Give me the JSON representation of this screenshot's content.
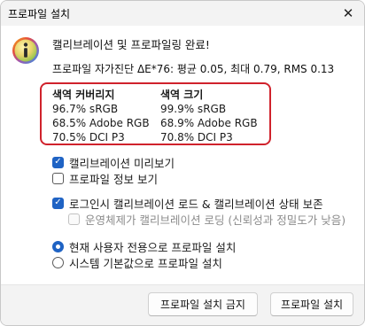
{
  "window": {
    "title": "프로파일 설치"
  },
  "message": {
    "heading": "캘리브레이션 및 프로파일링 완료!",
    "deltae": "프로파일 자가진단 ΔE*76: 평균 0.05, 최대 0.79, RMS 0.13"
  },
  "gamut": {
    "coverage": {
      "header": "색역 커버리지",
      "rows": [
        "96.7% sRGB",
        "68.5% Adobe RGB",
        "70.5% DCI P3"
      ]
    },
    "size": {
      "header": "색역 크기",
      "rows": [
        "99.9% sRGB",
        "68.9% Adobe RGB",
        "70.8% DCI P3"
      ]
    }
  },
  "options": {
    "preview": {
      "label": "캘리브레이션 미리보기",
      "checked": true
    },
    "profile_info": {
      "label": "프로파일 정보 보기",
      "checked": false
    },
    "login_load": {
      "label": "로그인시 캘리브레이션 로드 & 캘리브레이션 상태 보존",
      "checked": true
    },
    "os_load": {
      "label": "운영체제가 캘리브레이션 로딩 (신뢰성과 정밀도가 낮음)",
      "checked": false,
      "disabled": true
    }
  },
  "install_scope": {
    "current_user": {
      "label": "현재 사용자 전용으로 프로파일 설치",
      "selected": true
    },
    "system_default": {
      "label": "시스템 기본값으로 프로파일 설치",
      "selected": false
    }
  },
  "buttons": {
    "no_install": "프로파일 설치 금지",
    "install": "프로파일 설치"
  },
  "colors": {
    "accent": "#1f63c4",
    "highlight_border": "#d0222c"
  },
  "icons": {
    "info": "info-icon",
    "close": "close-icon",
    "check": "checkmark-icon"
  }
}
